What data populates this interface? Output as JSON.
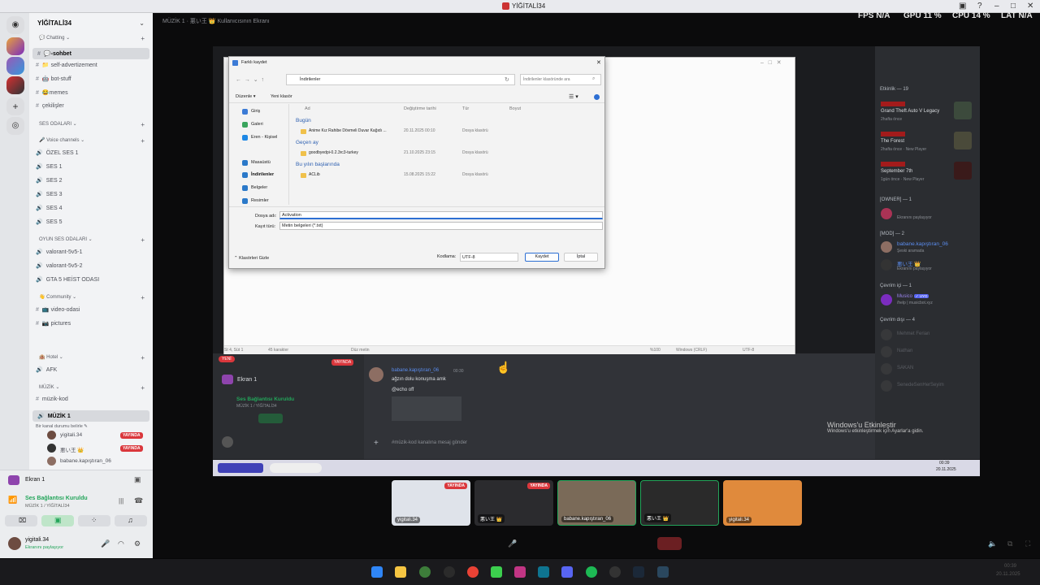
{
  "window": {
    "title": "YİĞİTALİ34"
  },
  "overlay": {
    "fps_label": "FPS",
    "fps_value": "N/A",
    "gpu_label": "GPU",
    "gpu_value": "11 %",
    "cpu_label": "CPU",
    "cpu_value": "14 %",
    "lat_label": "LAT",
    "lat_value": "N/A"
  },
  "topinfo": {
    "channel": "MÜZİK 1",
    "sep": "悪い王 👑",
    "screen_label": "Kullanıcısının Ekranı"
  },
  "server": {
    "name": "YİĞİTALİ34"
  },
  "channels": [
    {
      "kind": "cat",
      "label": "💬 Chatting ⌄"
    },
    {
      "kind": "text",
      "label": "💬-sohbet",
      "selected": true
    },
    {
      "kind": "text",
      "label": "📁 self-advertizement"
    },
    {
      "kind": "text",
      "label": "🤖 bot-stuff"
    },
    {
      "kind": "text",
      "label": "😂memes"
    },
    {
      "kind": "text",
      "label": "çekilişler"
    },
    {
      "kind": "cat",
      "label": "SES ODALARI ⌄"
    },
    {
      "kind": "cat",
      "label": "🎤 Voice channels ⌄"
    },
    {
      "kind": "voice",
      "label": "ÖZEL SES 1"
    },
    {
      "kind": "voice",
      "label": "SES 1"
    },
    {
      "kind": "voice",
      "label": "SES 2"
    },
    {
      "kind": "voice",
      "label": "SES 3"
    },
    {
      "kind": "voice",
      "label": "SES 4"
    },
    {
      "kind": "voice",
      "label": "SES 5"
    },
    {
      "kind": "cat",
      "label": "OYUN SES ODALARI ⌄"
    },
    {
      "kind": "voice",
      "label": "valorant-5v5-1"
    },
    {
      "kind": "voice",
      "label": "valorant-5v5-2"
    },
    {
      "kind": "voice",
      "label": "GTA 5 HEİST ODASI"
    },
    {
      "kind": "cat",
      "label": "👋 Community ⌄"
    },
    {
      "kind": "text",
      "label": "📺 video-odasi"
    },
    {
      "kind": "text",
      "label": "📷 pictures"
    },
    {
      "kind": "cat",
      "label": "🏨 Hotel ⌄"
    },
    {
      "kind": "voice",
      "label": "AFK"
    },
    {
      "kind": "cat",
      "label": "MÜZİK ⌄"
    },
    {
      "kind": "text",
      "label": "müzik-kod"
    },
    {
      "kind": "voice",
      "label": "MÜZİK 1",
      "selected": true
    }
  ],
  "status_hint": "Bir kanal durumu belirle ✎",
  "voice_users": [
    {
      "name": "yigitali.34",
      "live": "YAYINDA"
    },
    {
      "name": "悪い王 👑",
      "live": "YAYINDA"
    },
    {
      "name": "babane.kapıştıran_06",
      "live": ""
    }
  ],
  "panel": {
    "ekran": "Ekran 1",
    "voice_status": "Ses Bağlantısı Kuruldu",
    "voice_sub": "MÜZİK 1 / YİĞİTALİ34",
    "user": "yigitali.34",
    "user_sub": "Ekranını paylaşıyor"
  },
  "dialog": {
    "title": "Farklı kaydet",
    "path": "İndirilenler",
    "search": "İndirilenler klasöründe ara",
    "organize": "Düzenle ▾",
    "newfolder": "Yeni klasör",
    "cols": [
      "Ad",
      "Değiştirme tarihi",
      "Tür",
      "Boyut"
    ],
    "nav": [
      "Giriş",
      "Galeri",
      "Eren - Kişisel",
      "Masaüstü",
      "İndirilenler",
      "Belgeler",
      "Resimler"
    ],
    "groups": [
      {
        "label": "Bugün",
        "files": [
          {
            "name": "Anime Kız Rahibe Dövmeli Duvar Kağıdı ...",
            "date": "20.11.2025 00:10",
            "type": "Dosya klasörü"
          }
        ]
      },
      {
        "label": "Geçen ay",
        "files": [
          {
            "name": "goodbyedpi-0.2.3rc3-turkey",
            "date": "21.10.2025 23:15",
            "type": "Dosya klasörü"
          }
        ]
      },
      {
        "label": "Bu yılın başlarında",
        "files": [
          {
            "name": "ACLib",
            "date": "15.08.2025 15:22",
            "type": "Dosya klasörü"
          }
        ]
      }
    ],
    "filename_label": "Dosya adı:",
    "filename": "Activation",
    "type_label": "Kayıt türü:",
    "type": "Metin belgeleri (*.txt)",
    "hide": "Klasörleri Gizle",
    "encoding_label": "Kodlama:",
    "encoding": "UTF-8",
    "save": "Kaydet",
    "cancel": "İptal"
  },
  "notepad_status": {
    "pos": "St 4, Süt 1",
    "chars": "45 karakter",
    "mode": "Düz metin",
    "zoom": "%100",
    "eol": "Windows (CRLF)",
    "enc": "UTF-8"
  },
  "remote": {
    "activity_header": "Etkinlik — 19",
    "activities": [
      {
        "game": "Grand Theft Auto V Legacy",
        "sub": "2hafta önce"
      },
      {
        "game": "The Forest",
        "sub": "2hafta önce · New Player"
      },
      {
        "game": "September 7th",
        "sub": "1gün önce · New Player"
      }
    ],
    "owner_header": "[OWNER] — 1",
    "owner_sub": "Ekranını paylaşıyor",
    "mod_header": "[MOD] — 2",
    "mods": [
      {
        "name": "babane.kapıştıran_06",
        "sub": "Şeski aramada"
      },
      {
        "name": "悪い王 👑",
        "sub": "Ekranını paylaşıyor"
      }
    ],
    "online_header": "Çevrim içi — 1",
    "online": [
      {
        "name": "Musico",
        "tag": "✓ UYG",
        "sub": "/help | musicbot.xyz"
      }
    ],
    "offline_header": "Çevrim dışı — 4",
    "offline": [
      "Mehmet Ferian",
      "Nathan",
      "SAKAN",
      "SenedeSenHerSeyim"
    ],
    "message_author": "babane.kapıştıran_06",
    "message_time": "00:30",
    "message_lines": [
      "ağzın dolu konuşma amk",
      "@echo off"
    ],
    "input_placeholder": "#müzik-kod kanalına mesaj gönder",
    "ekran": "Ekran 1",
    "voice": "Ses Bağlantısı Kuruldu",
    "voice_sub": "MÜZİK 1 / YİĞİTALİ34",
    "new": "YENİ",
    "live": "YAYINDA",
    "clock": "00:39",
    "date": "20.11.2025",
    "watermark_title": "Windows'u Etkinleştir",
    "watermark_sub": "Windows'u etkinleştirmek için Ayarlar'a gidin."
  },
  "thumbs": [
    {
      "name": "yigitali.34",
      "live": "YAYINDA"
    },
    {
      "name": "悪い王 👑",
      "live": "YAYINDA"
    },
    {
      "name": "babane.kapıştıran_06",
      "live": ""
    },
    {
      "name": "悪い王 👑",
      "live": ""
    },
    {
      "name": "yigitali.34",
      "live": ""
    }
  ],
  "os": {
    "clock": "00:39",
    "date": "20.11.2025"
  }
}
